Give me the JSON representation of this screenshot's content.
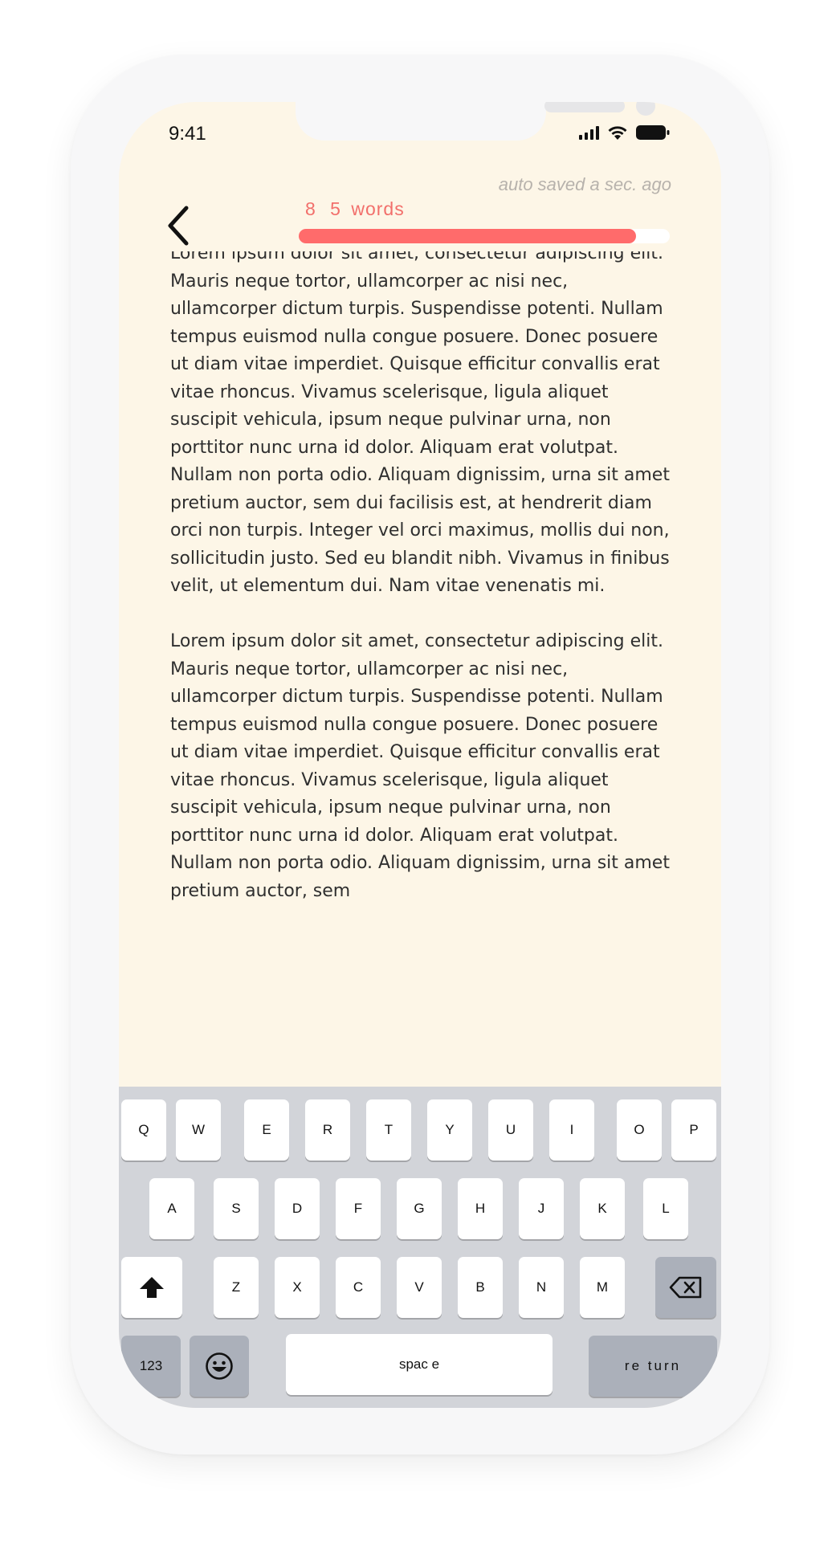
{
  "status_bar": {
    "time": "9:41"
  },
  "header": {
    "autosave_text": "auto saved a sec. ago",
    "word_count_number": "8 5",
    "word_count_label": "words",
    "progress_fraction": 0.91
  },
  "editor": {
    "paragraphs": [
      "Lorem ipsum dolor sit amet, consectetur adipiscing elit. Mauris neque tortor, ullamcorper ac nisi nec, ullamcorper dictum turpis. Suspendisse potenti. Nullam tempus euismod nulla congue posuere. Donec posuere ut diam vitae imperdiet. Quisque efficitur convallis erat vitae rhoncus. Vivamus scelerisque, ligula aliquet suscipit vehicula, ipsum neque pulvinar urna, non porttitor nunc urna id dolor. Aliquam erat volutpat. Nullam non porta odio. Aliquam dignissim, urna sit amet pretium auctor, sem dui facilisis est, at hendrerit diam orci non turpis. Integer vel orci maximus, mollis dui non, sollicitudin justo. Sed eu blandit nibh. Vivamus in finibus velit, ut elementum dui. Nam vitae venenatis mi.",
      "Lorem ipsum dolor sit amet, consectetur adipiscing elit. Mauris neque tortor, ullamcorper ac nisi nec, ullamcorper dictum turpis. Suspendisse potenti. Nullam tempus euismod nulla congue posuere. Donec posuere ut diam vitae imperdiet. Quisque efficitur convallis erat vitae rhoncus. Vivamus scelerisque, ligula aliquet suscipit vehicula, ipsum neque pulvinar urna, non porttitor nunc urna id dolor. Aliquam erat volutpat. Nullam non porta odio. Aliquam dignissim, urna sit amet pretium auctor, sem"
    ]
  },
  "keyboard": {
    "row1": [
      "Q",
      "W",
      "E",
      "R",
      "T",
      "Y",
      "U",
      "I",
      "O",
      "P"
    ],
    "row2": [
      "A",
      "S",
      "D",
      "F",
      "G",
      "H",
      "J",
      "K",
      "L"
    ],
    "row3": [
      "Z",
      "X",
      "C",
      "V",
      "B",
      "N",
      "M"
    ],
    "numbers_label": "123",
    "space_label": "spac   e",
    "return_label": "re turn",
    "bottom_left_symbol": "\"",
    "bottom_right_symbol": "!"
  },
  "colors": {
    "screen_background": "#fdf6e7",
    "accent": "#ff6b6b",
    "keyboard_background": "#d2d4d9"
  }
}
